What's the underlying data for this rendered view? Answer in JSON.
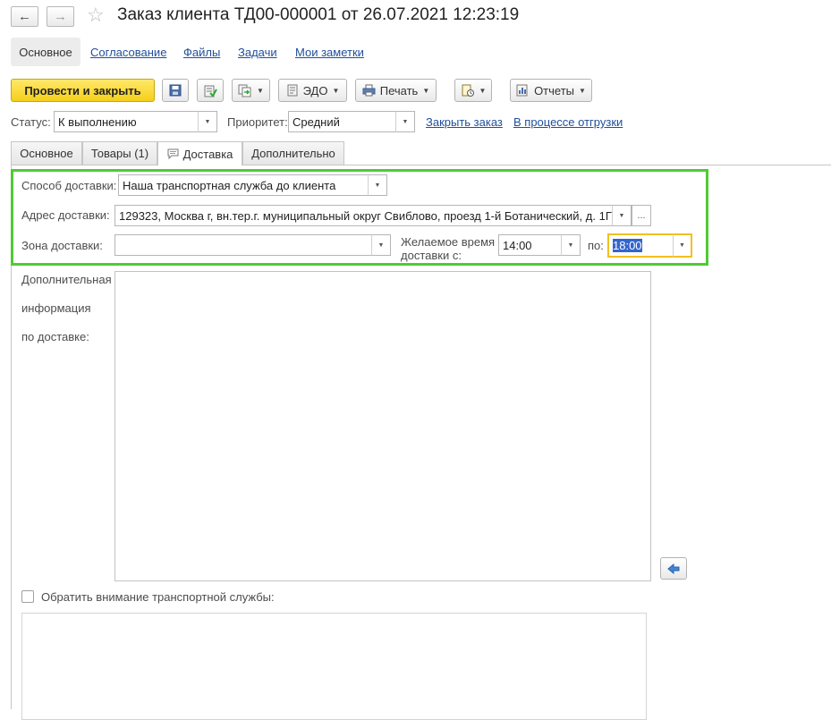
{
  "window": {
    "back_icon": "←",
    "forward_icon": "→",
    "favorite_icon": "☆",
    "title": "Заказ клиента ТД00-000001 от 26.07.2021 12:23:19"
  },
  "nav": {
    "main": "Основное",
    "links": [
      "Согласование",
      "Файлы",
      "Задачи",
      "Мои заметки"
    ]
  },
  "toolbar": {
    "post_close": "Провести и закрыть",
    "edo": "ЭДО",
    "print": "Печать",
    "reports": "Отчеты",
    "icons": [
      "save-icon",
      "post-icon",
      "create-based-on-icon",
      "edo-icon",
      "printer-icon",
      "attachments-icon",
      "reports-icon"
    ],
    "accent_color": "#f5cf1a"
  },
  "status": {
    "label": "Статус:",
    "value": "К выполнению",
    "priority_label": "Приоритет:",
    "priority_value": "Средний",
    "close_order": "Закрыть заказ",
    "in_shipping": "В процессе отгрузки"
  },
  "tabs": [
    {
      "label": "Основное"
    },
    {
      "label": "Товары (1)"
    },
    {
      "label": "Доставка"
    },
    {
      "label": "Дополнительно"
    }
  ],
  "delivery": {
    "method_label": "Способ доставки:",
    "method_value": "Наша транспортная служба до клиента",
    "address_label": "Адрес доставки:",
    "address_value": "129323, Москва г, вн.тер.г. муниципальный округ Свиблово, проезд 1-й Ботанический, д. 1Г",
    "address_more": "...",
    "zone_label": "Зона доставки:",
    "zone_value": "",
    "time_label_1": "Желаемое время",
    "time_label_2": "доставки с:",
    "time_from": "14:00",
    "to_label": "по:",
    "time_to": "18:00",
    "extra_info_label_1": "Дополнительная",
    "extra_info_label_2": "информация",
    "extra_info_label_3": "по доставке:",
    "extra_info_value": "",
    "attention_label": "Обратить внимание транспортной службы:",
    "attention_checked": false,
    "highlight_color": "#4fcb33"
  }
}
